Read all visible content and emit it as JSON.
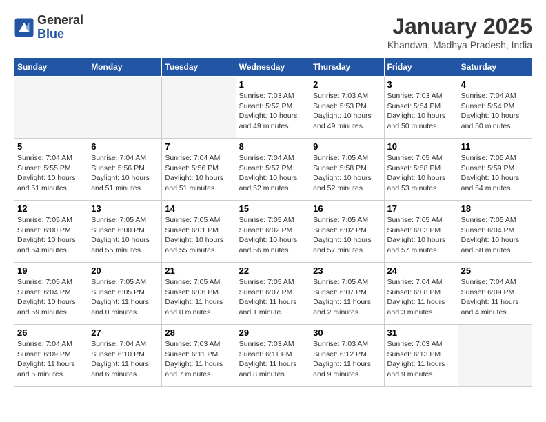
{
  "header": {
    "logo_general": "General",
    "logo_blue": "Blue",
    "title": "January 2025",
    "location": "Khandwa, Madhya Pradesh, India"
  },
  "weekdays": [
    "Sunday",
    "Monday",
    "Tuesday",
    "Wednesday",
    "Thursday",
    "Friday",
    "Saturday"
  ],
  "weeks": [
    [
      {
        "num": "",
        "info": ""
      },
      {
        "num": "",
        "info": ""
      },
      {
        "num": "",
        "info": ""
      },
      {
        "num": "1",
        "info": "Sunrise: 7:03 AM\nSunset: 5:52 PM\nDaylight: 10 hours and 49 minutes."
      },
      {
        "num": "2",
        "info": "Sunrise: 7:03 AM\nSunset: 5:53 PM\nDaylight: 10 hours and 49 minutes."
      },
      {
        "num": "3",
        "info": "Sunrise: 7:03 AM\nSunset: 5:54 PM\nDaylight: 10 hours and 50 minutes."
      },
      {
        "num": "4",
        "info": "Sunrise: 7:04 AM\nSunset: 5:54 PM\nDaylight: 10 hours and 50 minutes."
      }
    ],
    [
      {
        "num": "5",
        "info": "Sunrise: 7:04 AM\nSunset: 5:55 PM\nDaylight: 10 hours and 51 minutes."
      },
      {
        "num": "6",
        "info": "Sunrise: 7:04 AM\nSunset: 5:56 PM\nDaylight: 10 hours and 51 minutes."
      },
      {
        "num": "7",
        "info": "Sunrise: 7:04 AM\nSunset: 5:56 PM\nDaylight: 10 hours and 51 minutes."
      },
      {
        "num": "8",
        "info": "Sunrise: 7:04 AM\nSunset: 5:57 PM\nDaylight: 10 hours and 52 minutes."
      },
      {
        "num": "9",
        "info": "Sunrise: 7:05 AM\nSunset: 5:58 PM\nDaylight: 10 hours and 52 minutes."
      },
      {
        "num": "10",
        "info": "Sunrise: 7:05 AM\nSunset: 5:58 PM\nDaylight: 10 hours and 53 minutes."
      },
      {
        "num": "11",
        "info": "Sunrise: 7:05 AM\nSunset: 5:59 PM\nDaylight: 10 hours and 54 minutes."
      }
    ],
    [
      {
        "num": "12",
        "info": "Sunrise: 7:05 AM\nSunset: 6:00 PM\nDaylight: 10 hours and 54 minutes."
      },
      {
        "num": "13",
        "info": "Sunrise: 7:05 AM\nSunset: 6:00 PM\nDaylight: 10 hours and 55 minutes."
      },
      {
        "num": "14",
        "info": "Sunrise: 7:05 AM\nSunset: 6:01 PM\nDaylight: 10 hours and 55 minutes."
      },
      {
        "num": "15",
        "info": "Sunrise: 7:05 AM\nSunset: 6:02 PM\nDaylight: 10 hours and 56 minutes."
      },
      {
        "num": "16",
        "info": "Sunrise: 7:05 AM\nSunset: 6:02 PM\nDaylight: 10 hours and 57 minutes."
      },
      {
        "num": "17",
        "info": "Sunrise: 7:05 AM\nSunset: 6:03 PM\nDaylight: 10 hours and 57 minutes."
      },
      {
        "num": "18",
        "info": "Sunrise: 7:05 AM\nSunset: 6:04 PM\nDaylight: 10 hours and 58 minutes."
      }
    ],
    [
      {
        "num": "19",
        "info": "Sunrise: 7:05 AM\nSunset: 6:04 PM\nDaylight: 10 hours and 59 minutes."
      },
      {
        "num": "20",
        "info": "Sunrise: 7:05 AM\nSunset: 6:05 PM\nDaylight: 11 hours and 0 minutes."
      },
      {
        "num": "21",
        "info": "Sunrise: 7:05 AM\nSunset: 6:06 PM\nDaylight: 11 hours and 0 minutes."
      },
      {
        "num": "22",
        "info": "Sunrise: 7:05 AM\nSunset: 6:07 PM\nDaylight: 11 hours and 1 minute."
      },
      {
        "num": "23",
        "info": "Sunrise: 7:05 AM\nSunset: 6:07 PM\nDaylight: 11 hours and 2 minutes."
      },
      {
        "num": "24",
        "info": "Sunrise: 7:04 AM\nSunset: 6:08 PM\nDaylight: 11 hours and 3 minutes."
      },
      {
        "num": "25",
        "info": "Sunrise: 7:04 AM\nSunset: 6:09 PM\nDaylight: 11 hours and 4 minutes."
      }
    ],
    [
      {
        "num": "26",
        "info": "Sunrise: 7:04 AM\nSunset: 6:09 PM\nDaylight: 11 hours and 5 minutes."
      },
      {
        "num": "27",
        "info": "Sunrise: 7:04 AM\nSunset: 6:10 PM\nDaylight: 11 hours and 6 minutes."
      },
      {
        "num": "28",
        "info": "Sunrise: 7:03 AM\nSunset: 6:11 PM\nDaylight: 11 hours and 7 minutes."
      },
      {
        "num": "29",
        "info": "Sunrise: 7:03 AM\nSunset: 6:11 PM\nDaylight: 11 hours and 8 minutes."
      },
      {
        "num": "30",
        "info": "Sunrise: 7:03 AM\nSunset: 6:12 PM\nDaylight: 11 hours and 9 minutes."
      },
      {
        "num": "31",
        "info": "Sunrise: 7:03 AM\nSunset: 6:13 PM\nDaylight: 11 hours and 9 minutes."
      },
      {
        "num": "",
        "info": ""
      }
    ]
  ]
}
